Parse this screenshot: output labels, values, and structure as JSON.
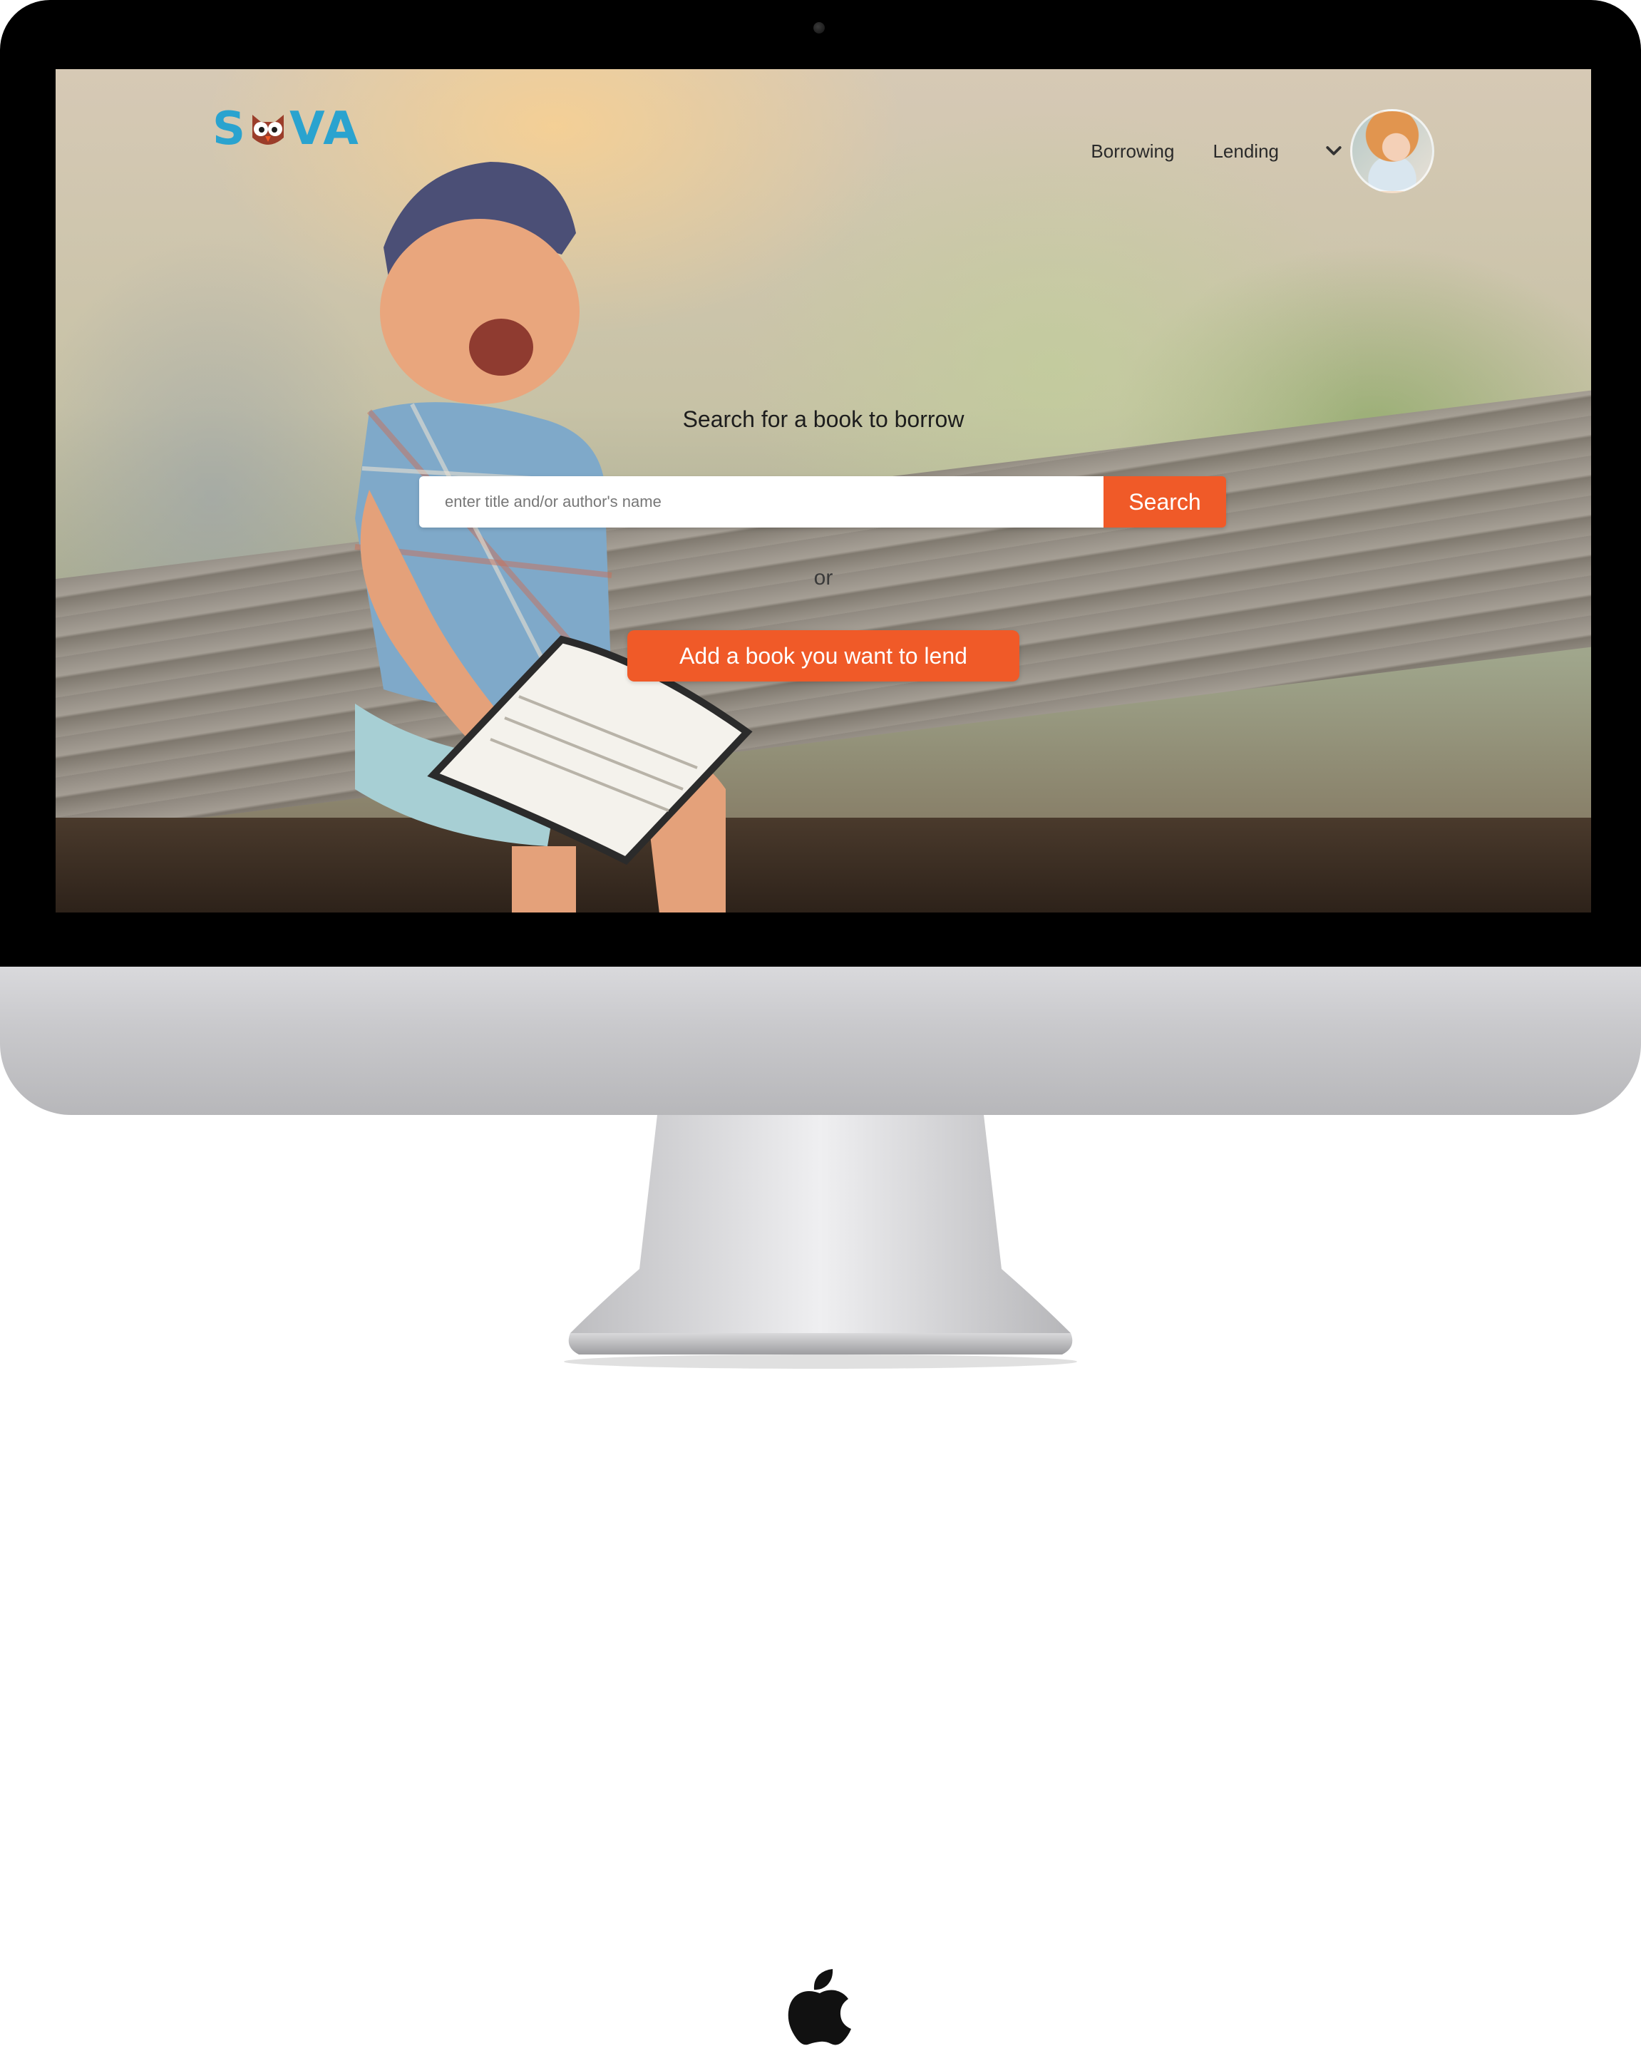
{
  "header": {
    "logo_text_left": "S",
    "logo_text_right": "VA",
    "nav": {
      "borrowing_label": "Borrowing",
      "lending_label": "Lending"
    },
    "dropdown_icon": "chevron-down-icon",
    "avatar_icon": "user-avatar"
  },
  "hero": {
    "title": "Search for a book to borrow",
    "search": {
      "placeholder": "enter title and/or author's name",
      "value": "",
      "button_label": "Search"
    },
    "or_text": "or",
    "lend_button_label": "Add a book you want to lend"
  },
  "colors": {
    "brand_blue": "#2aa3cf",
    "accent_orange": "#f05a28",
    "text_dark": "#1d1d1d"
  }
}
